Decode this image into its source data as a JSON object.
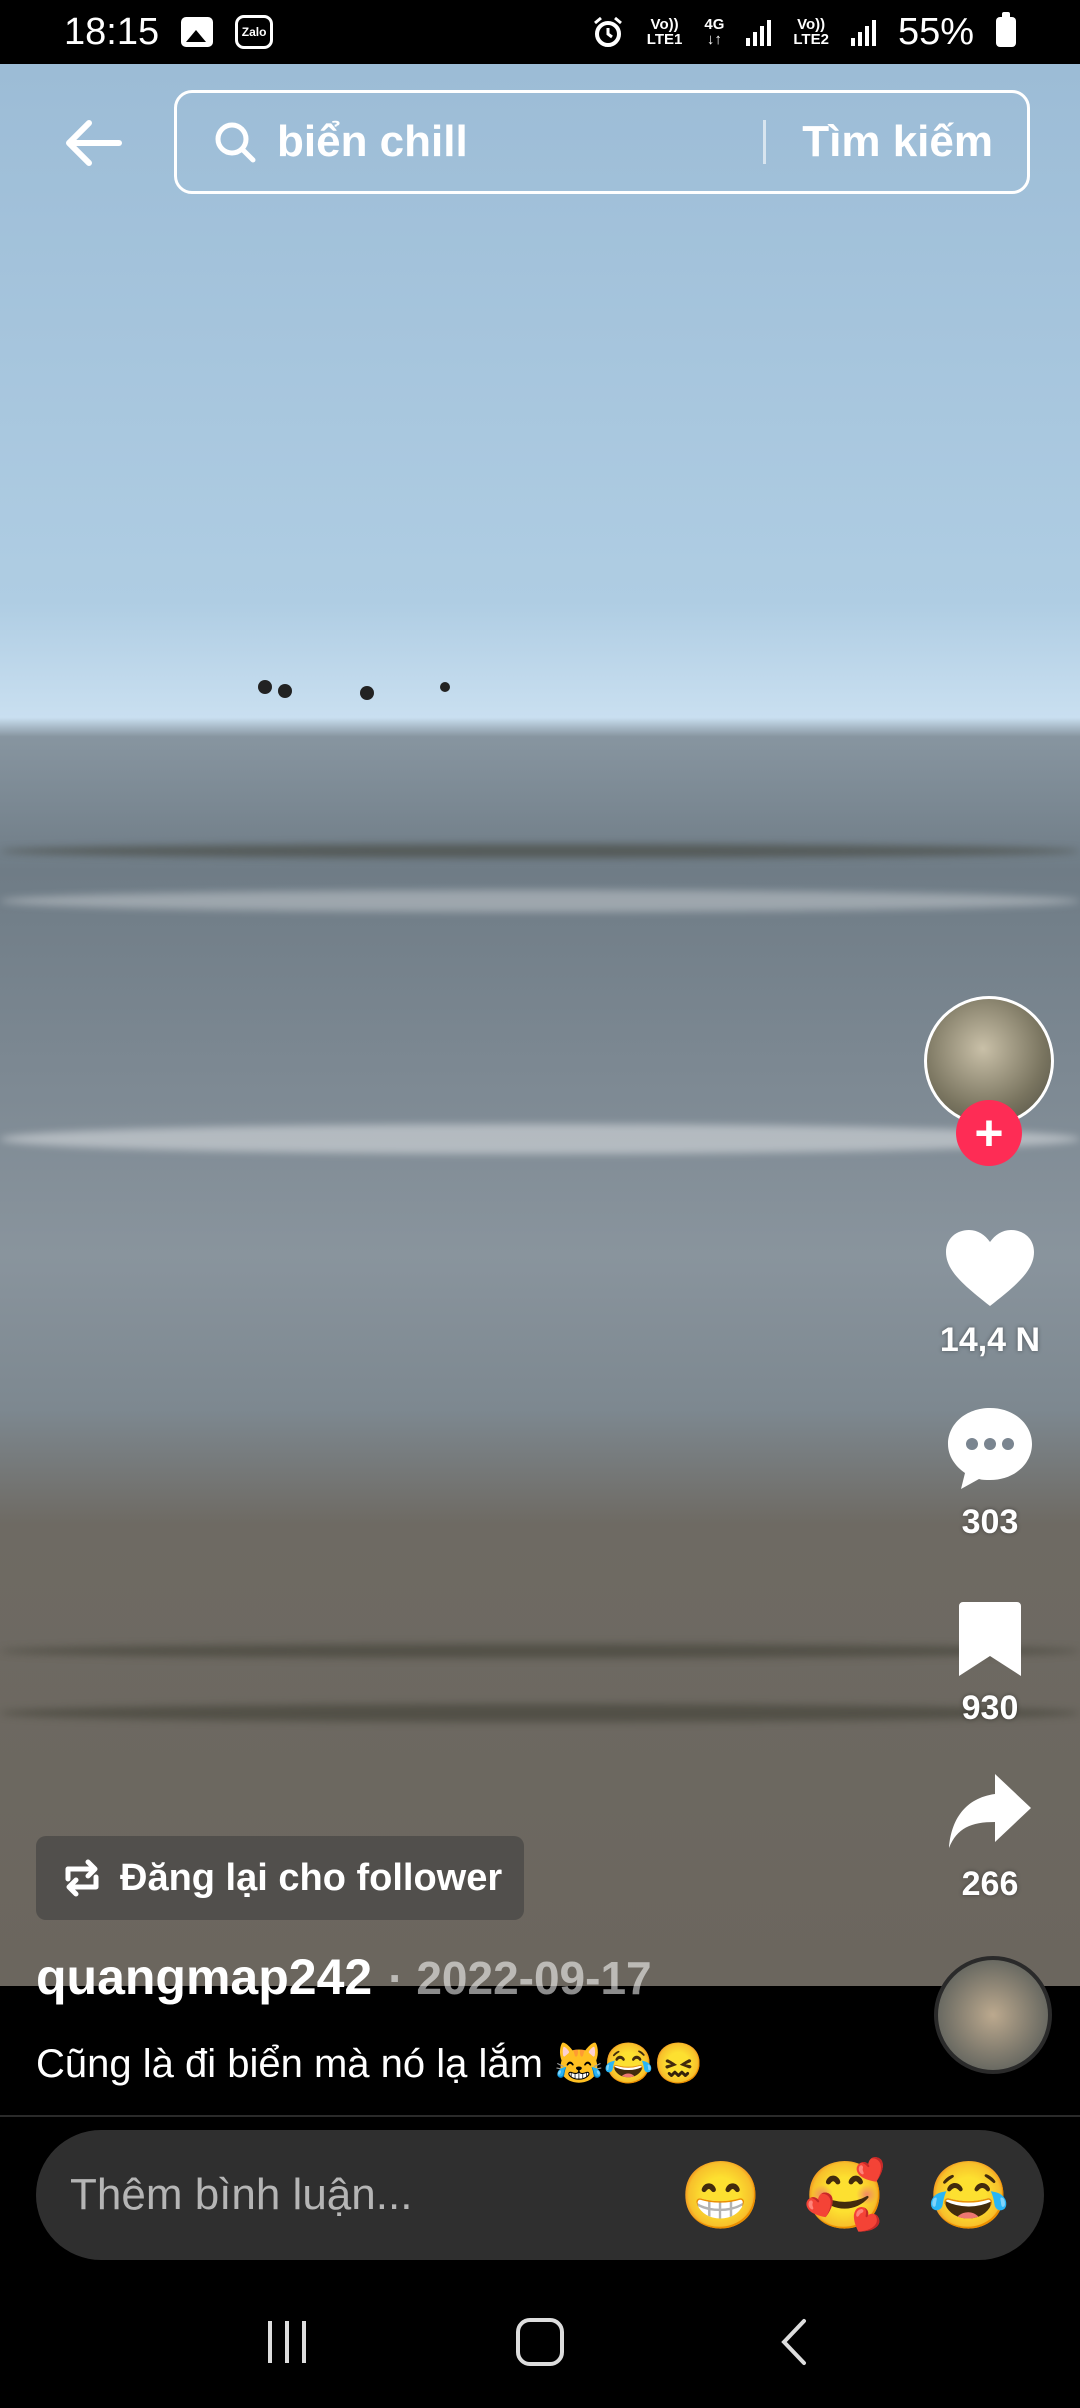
{
  "status_bar": {
    "time": "18:15",
    "net1_line1": "Vo))",
    "net1_line2": "LTE1",
    "net_4g": "4G",
    "net2_line1": "Vo))",
    "net2_line2": "LTE2",
    "battery": "55%",
    "icons": [
      "gallery-icon",
      "zalo-icon",
      "alarm-icon",
      "signal-icon",
      "battery-icon"
    ]
  },
  "search": {
    "query": "biển chill",
    "button": "Tìm kiếm"
  },
  "actions": {
    "likes": "14,4 N",
    "comments": "303",
    "saves": "930",
    "shares": "266"
  },
  "post": {
    "repost_label": "Đăng lại cho follower",
    "author": "quangmap242",
    "date": "· 2022-09-17",
    "caption": "Cũng là đi biển mà nó lạ lắm 😹😂😖"
  },
  "comment": {
    "placeholder": "Thêm bình luận...",
    "emojis": [
      "😁",
      "🥰",
      "😂"
    ]
  },
  "colors": {
    "accent": "#fe2c55",
    "comment_bg": "#2f2f2f"
  }
}
